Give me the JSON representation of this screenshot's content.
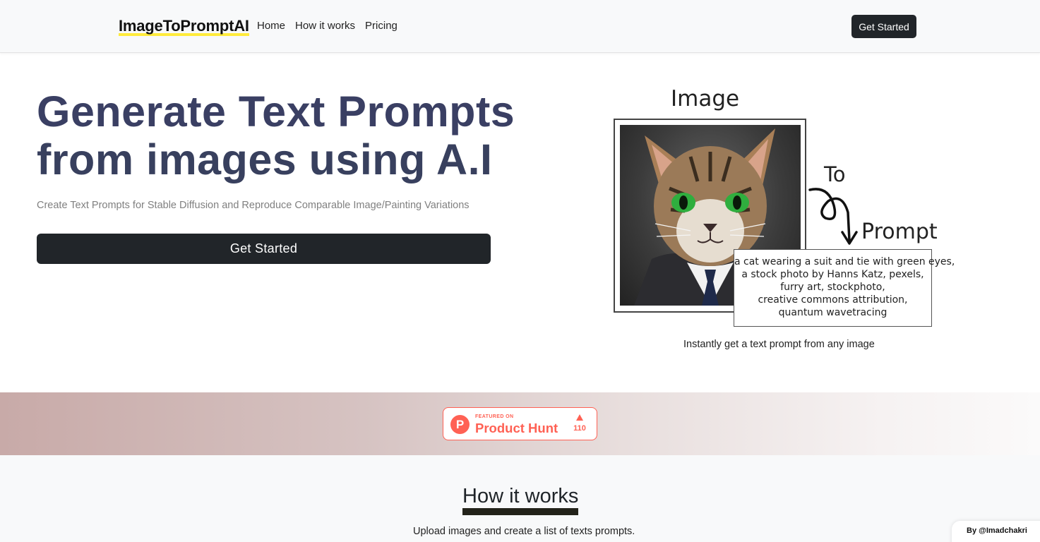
{
  "navbar": {
    "brand": "ImageToPromptAI",
    "links": [
      "Home",
      "How it works",
      "Pricing"
    ],
    "cta_label": "Get Started"
  },
  "hero": {
    "title_line1": "Generate Text Prompts",
    "title_line2": "from images using A.I",
    "subtitle": "Create Text Prompts for Stable Diffusion and Reproduce Comparable Image/Painting Variations",
    "cta_label": "Get Started"
  },
  "illustration": {
    "label_image": "Image",
    "label_to": "To",
    "label_prompt": "Prompt",
    "prompt_lines": [
      "a cat wearing a suit and tie with green eyes,",
      "a stock photo by Hanns Katz, pexels,",
      "furry art, stockphoto,",
      "creative commons attribution,",
      "quantum wavetracing"
    ],
    "caption": "Instantly get a text prompt from any image"
  },
  "product_hunt": {
    "featured": "FEATURED ON",
    "name": "Product Hunt",
    "count": "110",
    "color": "#ff6154"
  },
  "how_it_works": {
    "title": "How it works",
    "subtitle": "Upload images and create a list of texts prompts."
  },
  "footer_tag": "By @Imadchakri",
  "colors": {
    "dark_button": "#212529",
    "hero_title": "#3a3f63",
    "brand_highlight": "#ffeb3b"
  }
}
